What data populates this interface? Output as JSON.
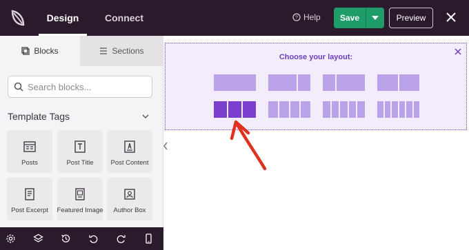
{
  "header": {
    "tabs": [
      {
        "label": "Design",
        "active": true
      },
      {
        "label": "Connect",
        "active": false
      }
    ],
    "help_label": "Help",
    "save_label": "Save",
    "preview_label": "Preview"
  },
  "sidebar": {
    "tabs": [
      {
        "label": "Blocks",
        "icon": "blocks-icon"
      },
      {
        "label": "Sections",
        "icon": "sections-icon"
      }
    ],
    "search_placeholder": "Search blocks...",
    "section_title": "Template Tags",
    "blocks": [
      {
        "label": "Posts",
        "icon": "posts-icon"
      },
      {
        "label": "Post Title",
        "icon": "post-title-icon"
      },
      {
        "label": "Post Content",
        "icon": "post-content-icon"
      },
      {
        "label": "Post Excerpt",
        "icon": "post-excerpt-icon"
      },
      {
        "label": "Featured Image",
        "icon": "featured-image-icon"
      },
      {
        "label": "Author Box",
        "icon": "author-box-icon"
      }
    ],
    "bottom_icons": [
      "settings-icon",
      "layers-icon",
      "history-icon",
      "undo-icon",
      "redo-icon",
      "mobile-preview-icon"
    ]
  },
  "layout_chooser": {
    "title": "Choose your layout:",
    "options": [
      {
        "columns": 1,
        "selected": false
      },
      {
        "columns": 2,
        "selected": false
      },
      {
        "columns": 2,
        "selected": false
      },
      {
        "columns": 2,
        "selected": false
      },
      {
        "columns": 3,
        "selected": true
      },
      {
        "columns": 4,
        "selected": false
      },
      {
        "columns": 5,
        "selected": false
      },
      {
        "columns": 6,
        "selected": false
      }
    ]
  },
  "colors": {
    "topbar": "#2a1a2b",
    "save_green": "#1e9c6a",
    "accent_purple": "#6b3fbf",
    "layout_idle": "#b9a2e8",
    "layout_selected": "#7b3fcf",
    "arrow_red": "#e0301e"
  }
}
